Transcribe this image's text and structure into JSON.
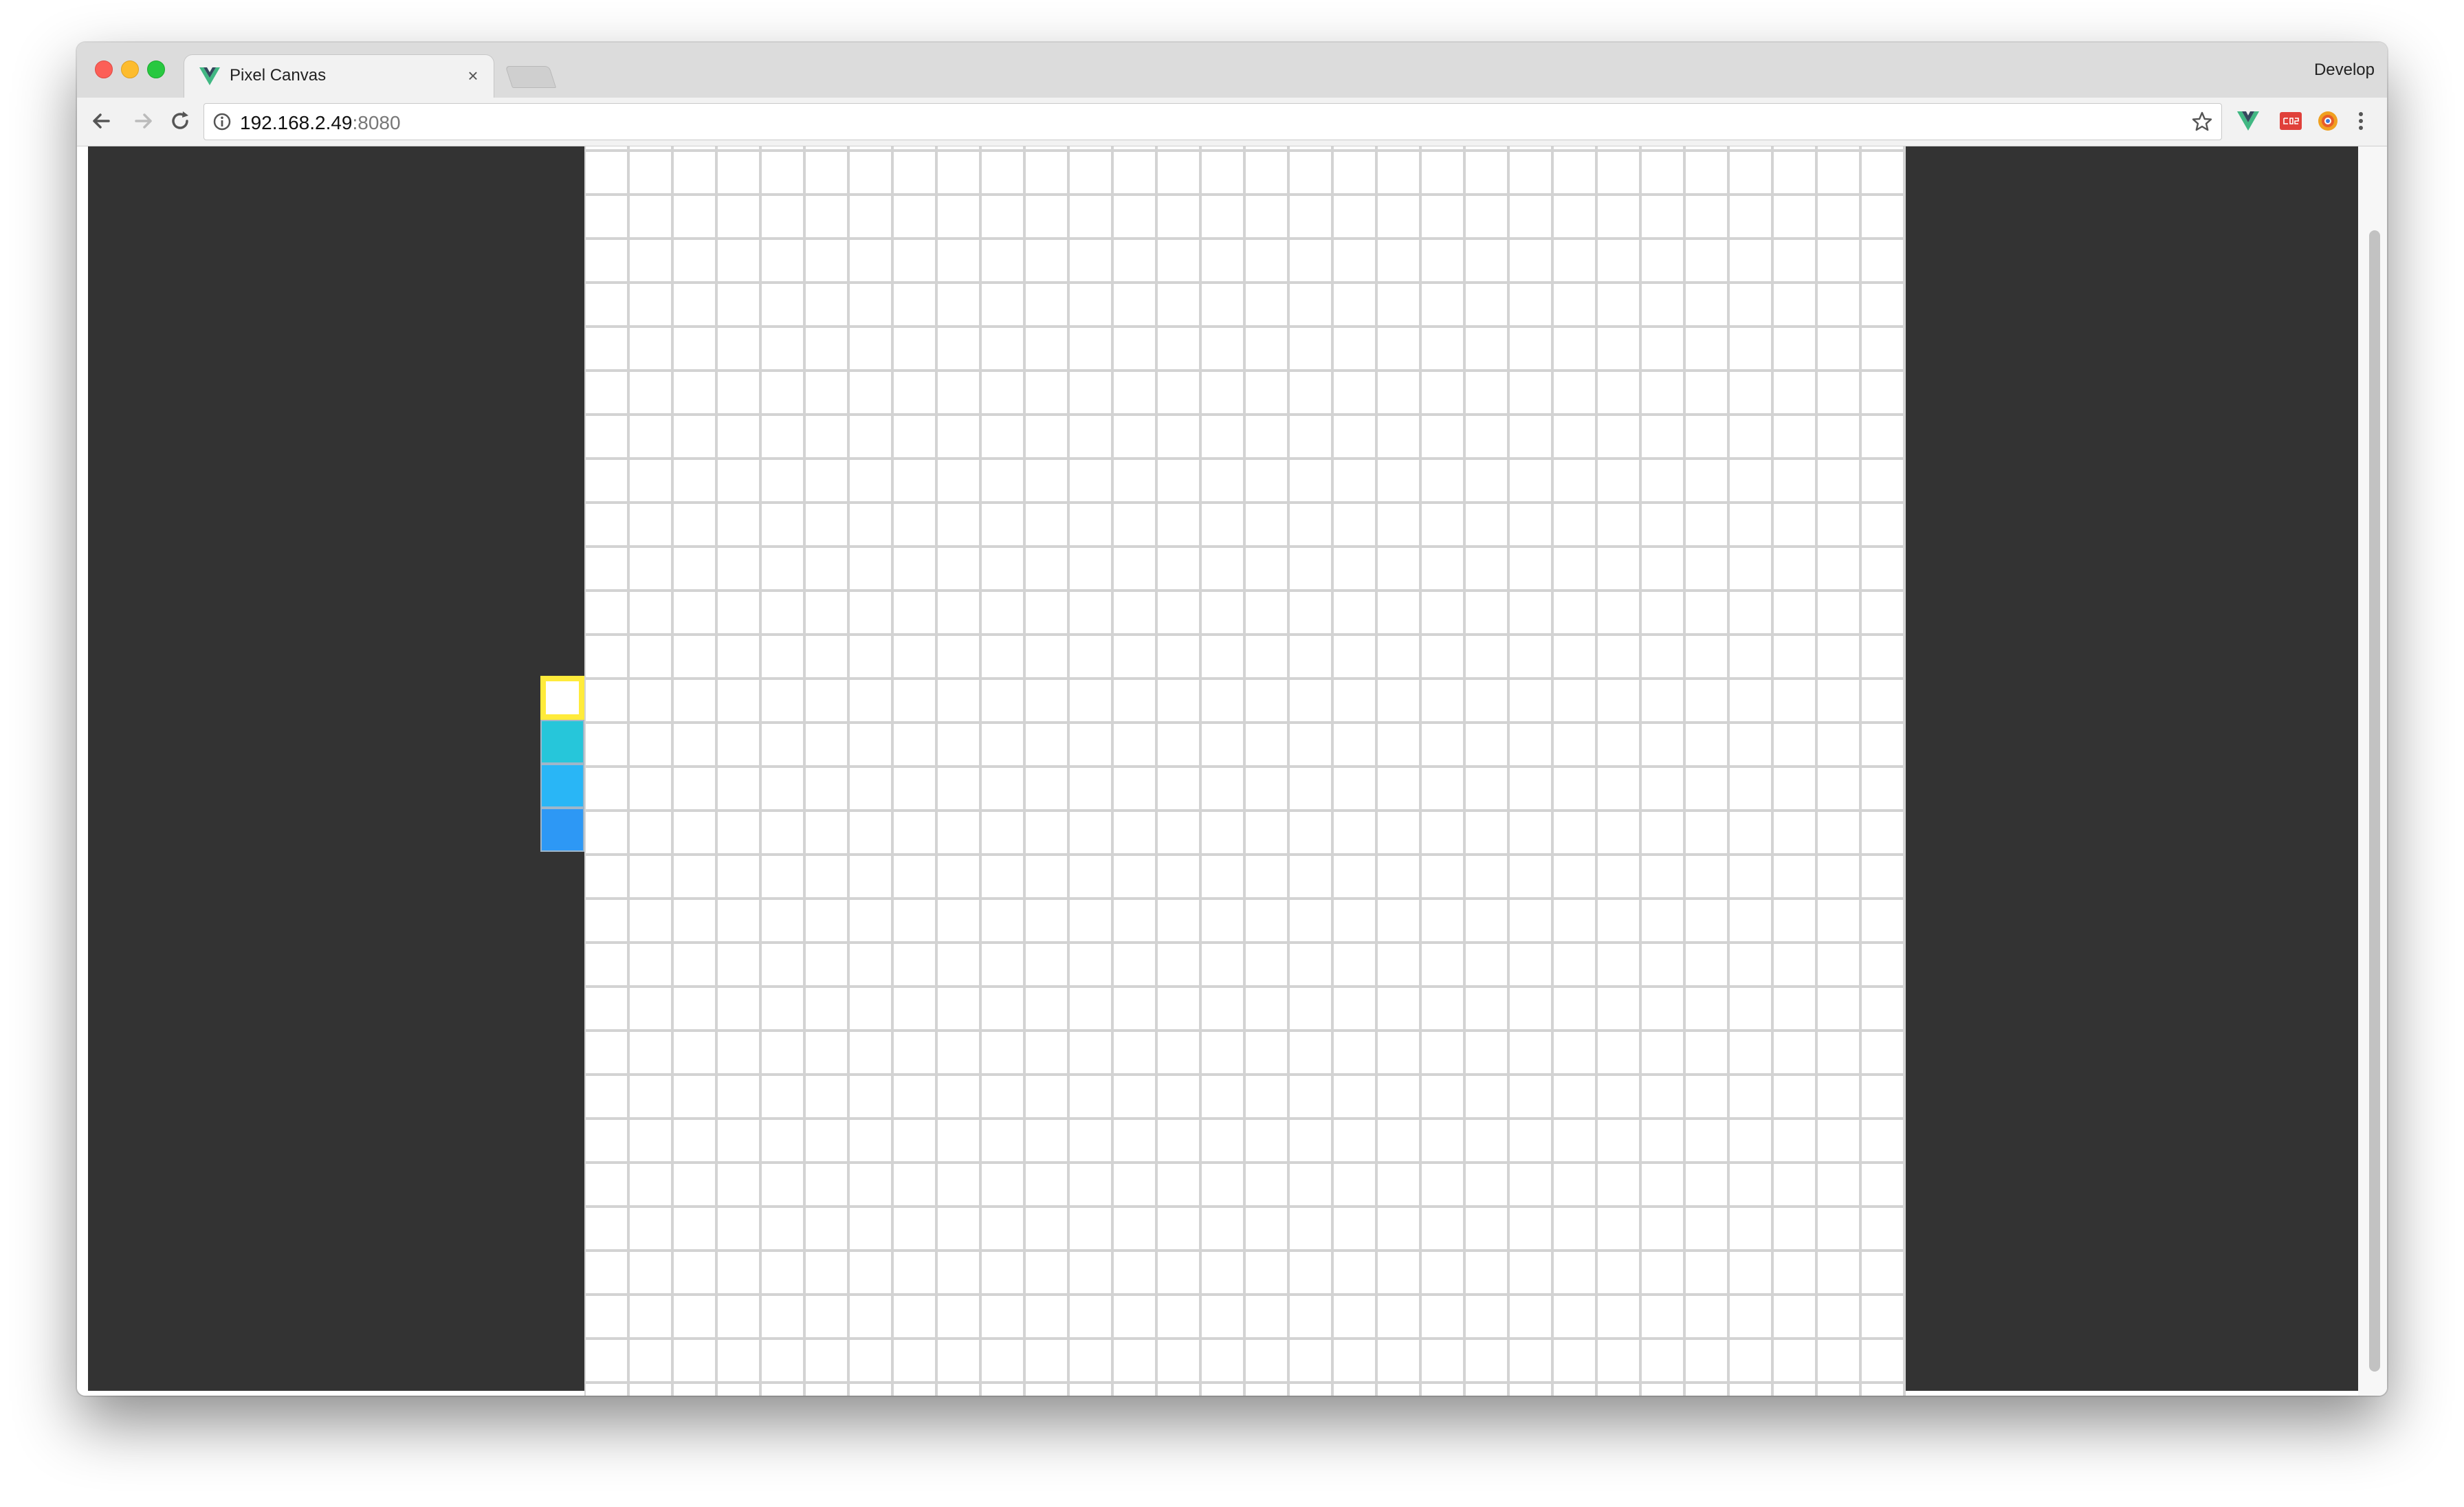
{
  "browser": {
    "tab_title": "Pixel Canvas",
    "tab_close": "×",
    "profile_label": "Develop",
    "url_host": "192.168.2.49",
    "url_port": ":8080"
  },
  "extensions": [
    "vue-devtools-icon",
    "cors-icon",
    "color-picker-icon",
    "menu-icon"
  ],
  "page": {
    "side_panel_color": "#333333",
    "canvas_background": "#ffffff",
    "grid_line_color": "#d3d3d3",
    "palette": [
      {
        "color": "#ffffff",
        "selected": true
      },
      {
        "color": "#26c6da",
        "selected": false
      },
      {
        "color": "#29b6f6",
        "selected": false
      },
      {
        "color": "#2d98f5",
        "selected": false
      }
    ]
  }
}
